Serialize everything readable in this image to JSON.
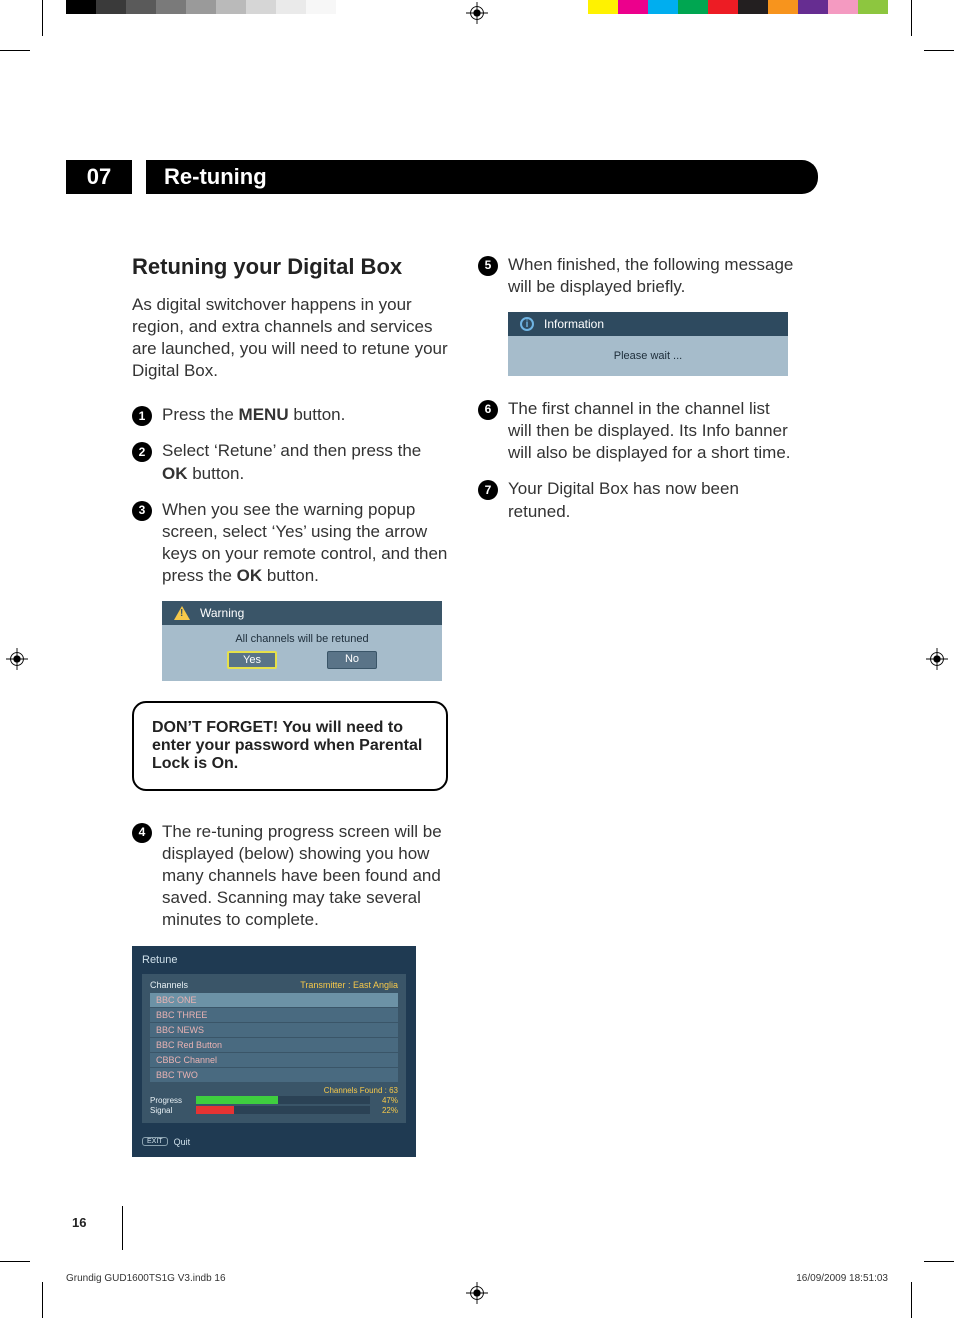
{
  "calibration": {
    "left": [
      "#000000",
      "#3a3a3a",
      "#5a5a5a",
      "#7a7a7a",
      "#9a9a9a",
      "#bababa",
      "#d6d6d6",
      "#eaeaea",
      "#f7f7f7",
      "#ffffff"
    ],
    "right": [
      "#fff200",
      "#ec008c",
      "#00aeef",
      "#00a651",
      "#ed1c24",
      "#231f20",
      "#f7941d",
      "#662d91",
      "#f49ac1",
      "#8dc63f"
    ]
  },
  "chapter": {
    "number": "07",
    "title": "Re-tuning"
  },
  "heading": "Retuning your Digital Box",
  "intro": "As digital switchover happens in your region, and extra channels and services are launched, you will need to retune your Digital Box.",
  "steps": {
    "s1_pre": "Press the ",
    "s1_bold": "MENU",
    "s1_post": " button.",
    "s2_pre": "Select ‘Retune’ and then press the ",
    "s2_bold": "OK",
    "s2_post": " button.",
    "s3_pre": "When you see the warning popup screen, select ‘Yes’ using the arrow keys on your remote control, and then press the ",
    "s3_bold": "OK",
    "s3_post": " button.",
    "s4": "The re-tuning progress screen will be displayed (below) showing you how many channels have been found and saved. Scanning may take several minutes to complete.",
    "s5": "When finished, the following message will be displayed briefly.",
    "s6": "The first channel in the channel list will then be displayed. Its Info banner will also be displayed for a short time.",
    "s7": "Your Digital Box has now been retuned."
  },
  "warning_dialog": {
    "title": "Warning",
    "message": "All channels will be retuned",
    "yes": "Yes",
    "no": "No"
  },
  "note": "DON’T FORGET! You will need to enter your password when Parental Lock is On.",
  "retune": {
    "title": "Retune",
    "channels_label": "Channels",
    "transmitter_label": "Transmitter :",
    "transmitter_value": "East Anglia",
    "channels": [
      "BBC ONE",
      "BBC THREE",
      "BBC NEWS",
      "BBC Red Button",
      "CBBC Channel",
      "BBC TWO"
    ],
    "found_label": "Channels Found :",
    "found_value": "63",
    "progress_label": "Progress",
    "progress_pct": "47%",
    "signal_label": "Signal",
    "signal_pct": "22%",
    "exit_key": "EXIT",
    "exit_label": "Quit"
  },
  "info_dialog": {
    "title": "Information",
    "message": "Please wait ..."
  },
  "page_number": "16",
  "footer": {
    "file": "Grundig GUD1600TS1G V3.indb   16",
    "date": "16/09/2009   18:51:03"
  }
}
